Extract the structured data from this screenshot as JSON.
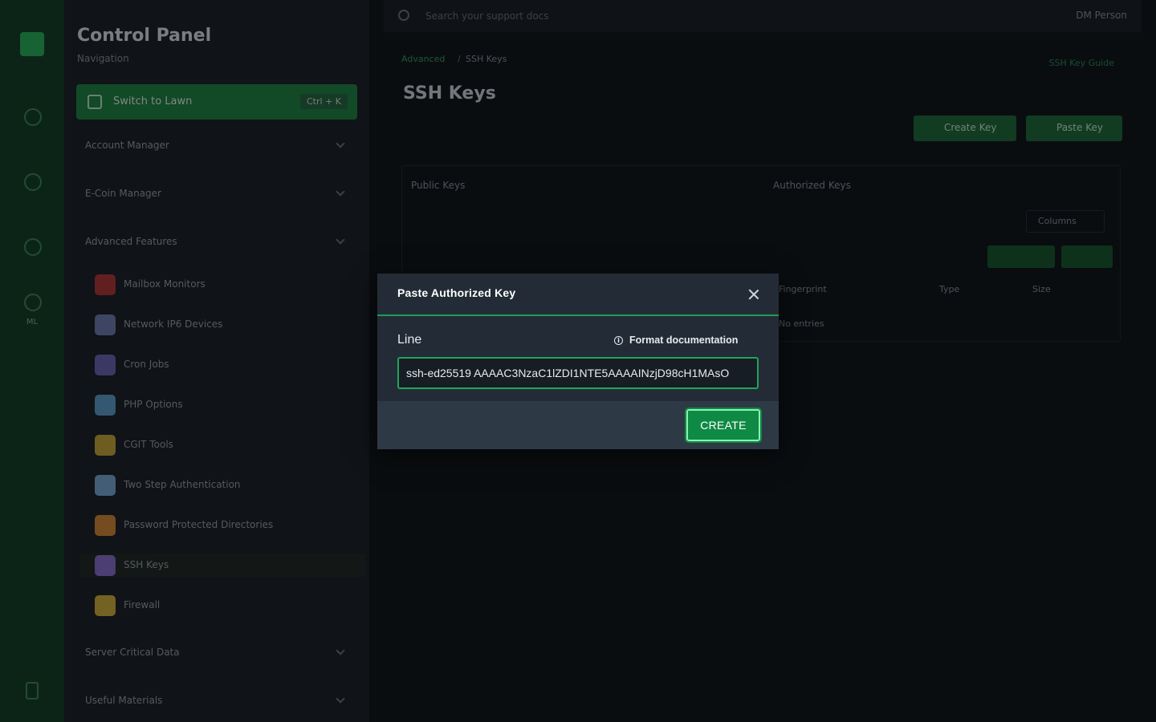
{
  "app": {
    "title": "Control Panel",
    "subtitle": "Navigation",
    "rail_label": "ML"
  },
  "sidebar": {
    "active_item": {
      "label": "Switch to Lawn",
      "shortcut": "Ctrl + K"
    },
    "sections": [
      {
        "label": "Account Manager"
      },
      {
        "label": "E-Coin Manager"
      },
      {
        "label": "Advanced Features"
      },
      {
        "label": "Server Critical Data"
      },
      {
        "label": "Useful Materials"
      }
    ],
    "items": [
      {
        "label": "Mailbox Monitors",
        "icon": "mail-icon",
        "color": "#b33a3a"
      },
      {
        "label": "Network IP6 Devices",
        "icon": "network-icon",
        "color": "#6f7fb5"
      },
      {
        "label": "Cron Jobs",
        "icon": "clock-icon",
        "color": "#6d67b8"
      },
      {
        "label": "PHP Options",
        "icon": "globe-icon",
        "color": "#5f9fd0"
      },
      {
        "label": "CGIT Tools",
        "icon": "tools-icon",
        "color": "#c6a93b"
      },
      {
        "label": "Two Step Authentication",
        "icon": "shield-icon",
        "color": "#7aa9d8"
      },
      {
        "label": "Password Protected Directories",
        "icon": "folder-lock-icon",
        "color": "#d58a3a"
      },
      {
        "label": "SSH Keys",
        "icon": "key-icon",
        "color": "#8b6fd0"
      },
      {
        "label": "Firewall",
        "icon": "firewall-icon",
        "color": "#d2b23c"
      }
    ]
  },
  "main": {
    "search_placeholder": "Search your support docs",
    "user": "DM Person",
    "breadcrumb": {
      "parent": "Advanced",
      "separator": "/",
      "current": "SSH Keys"
    },
    "help_link": "SSH Key Guide",
    "page_title": "SSH Keys",
    "buttons": {
      "create_key": "Create Key",
      "paste_key": "Paste Key"
    },
    "panel_cols": {
      "public_keys": "Public Keys",
      "authorized_keys": "Authorized Keys"
    },
    "select_value": "Columns",
    "table_headers": {
      "fingerprint": "Fingerprint",
      "type": "Type",
      "size": "Size"
    },
    "empty_text": "No entries"
  },
  "modal": {
    "title": "Paste Authorized Key",
    "field_label": "Line",
    "doc_link": "Format documentation",
    "input_value": "ssh-ed25519 AAAAC3NzaC1lZDI1NTE5AAAAINzjD98cH1MAsO",
    "create_label": "CREATE",
    "accent": "#1f9a55"
  }
}
